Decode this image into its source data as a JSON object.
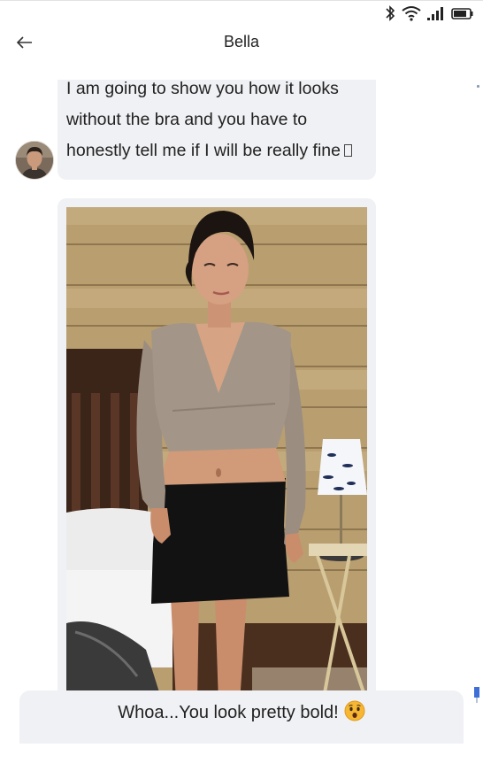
{
  "header": {
    "title": "Bella",
    "back_icon": "arrow-left-icon"
  },
  "status_bar": {
    "icons": [
      "bluetooth-icon",
      "wifi-icon",
      "cellular-signal-icon",
      "battery-icon"
    ]
  },
  "messages": [
    {
      "sender": "Bella",
      "type": "text",
      "lines": [
        "I am going to show you how it looks",
        "without the bra and you have to",
        "honestly tell me if I will be really fine"
      ],
      "trailing_icon": "missing-emoji-glyph"
    },
    {
      "sender": "Bella",
      "type": "image",
      "image_subject": "woman-in-beige-wrap-top-and-black-skirt-photo"
    }
  ],
  "reply": {
    "text": "Whoa...You look pretty bold!",
    "emoji": "astonished-face-emoji"
  },
  "colors": {
    "bubble_bg": "#f0f1f4",
    "scroll_accent": "#3d6fd6",
    "emoji_yellow": "#f7b733"
  }
}
